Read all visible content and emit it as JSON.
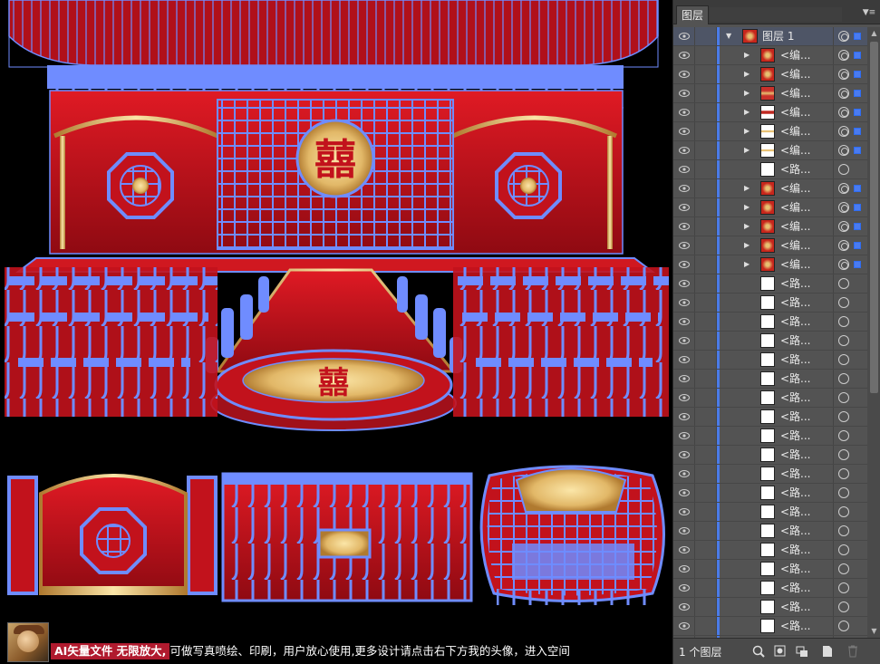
{
  "panel": {
    "tab_label": "图层",
    "menu_icon": "panel-menu-icon",
    "layer_count_text": "1 个图层"
  },
  "layers": {
    "top": {
      "name": "图层 1",
      "expanded": true
    },
    "items": [
      {
        "name": "<编...",
        "thumb": "th-red",
        "expandable": true,
        "target_filled": true
      },
      {
        "name": "<编...",
        "thumb": "th-red",
        "expandable": true,
        "target_filled": true
      },
      {
        "name": "<编...",
        "thumb": "th-gold",
        "expandable": true,
        "target_filled": true
      },
      {
        "name": "<编...",
        "thumb": "th-stripe",
        "expandable": true,
        "target_filled": true
      },
      {
        "name": "<编...",
        "thumb": "th-goldline",
        "expandable": true,
        "target_filled": true
      },
      {
        "name": "<编...",
        "thumb": "th-goldline",
        "expandable": true,
        "target_filled": true
      },
      {
        "name": "<路...",
        "thumb": "th-white",
        "expandable": false,
        "target_filled": false
      },
      {
        "name": "<编...",
        "thumb": "th-red",
        "expandable": true,
        "target_filled": true
      },
      {
        "name": "<编...",
        "thumb": "th-red",
        "expandable": true,
        "target_filled": true
      },
      {
        "name": "<编...",
        "thumb": "th-red",
        "expandable": true,
        "target_filled": true
      },
      {
        "name": "<编...",
        "thumb": "th-red",
        "expandable": true,
        "target_filled": true
      },
      {
        "name": "<编...",
        "thumb": "th-red",
        "expandable": true,
        "target_filled": true
      },
      {
        "name": "<路...",
        "thumb": "th-white",
        "expandable": false,
        "target_filled": false
      },
      {
        "name": "<路...",
        "thumb": "th-white",
        "expandable": false,
        "target_filled": false
      },
      {
        "name": "<路...",
        "thumb": "th-white",
        "expandable": false,
        "target_filled": false
      },
      {
        "name": "<路...",
        "thumb": "th-white",
        "expandable": false,
        "target_filled": false
      },
      {
        "name": "<路...",
        "thumb": "th-white",
        "expandable": false,
        "target_filled": false
      },
      {
        "name": "<路...",
        "thumb": "th-white",
        "expandable": false,
        "target_filled": false
      },
      {
        "name": "<路...",
        "thumb": "th-white",
        "expandable": false,
        "target_filled": false
      },
      {
        "name": "<路...",
        "thumb": "th-white",
        "expandable": false,
        "target_filled": false
      },
      {
        "name": "<路...",
        "thumb": "th-white",
        "expandable": false,
        "target_filled": false
      },
      {
        "name": "<路...",
        "thumb": "th-white",
        "expandable": false,
        "target_filled": false
      },
      {
        "name": "<路...",
        "thumb": "th-white",
        "expandable": false,
        "target_filled": false
      },
      {
        "name": "<路...",
        "thumb": "th-white",
        "expandable": false,
        "target_filled": false
      },
      {
        "name": "<路...",
        "thumb": "th-white",
        "expandable": false,
        "target_filled": false
      },
      {
        "name": "<路...",
        "thumb": "th-white",
        "expandable": false,
        "target_filled": false
      },
      {
        "name": "<路...",
        "thumb": "th-white",
        "expandable": false,
        "target_filled": false
      },
      {
        "name": "<路...",
        "thumb": "th-white",
        "expandable": false,
        "target_filled": false
      },
      {
        "name": "<路...",
        "thumb": "th-white",
        "expandable": false,
        "target_filled": false
      },
      {
        "name": "<路...",
        "thumb": "th-white",
        "expandable": false,
        "target_filled": false
      },
      {
        "name": "<路...",
        "thumb": "th-white",
        "expandable": false,
        "target_filled": false
      },
      {
        "name": "<路...",
        "thumb": "th-white",
        "expandable": false,
        "target_filled": false
      }
    ]
  },
  "footer_buttons": [
    {
      "name": "locate-object-icon"
    },
    {
      "name": "make-clipping-mask-icon"
    },
    {
      "name": "new-sublayer-icon"
    },
    {
      "name": "new-layer-icon"
    },
    {
      "name": "delete-layer-icon"
    }
  ],
  "banner": {
    "highlight": "AI矢量文件 无限放大,",
    "rest": "可做写真喷绘、印刷，用户放心使用,更多设计请点击右下方我的头像，进入空间"
  },
  "colors": {
    "selection_blue": "#4a7bf0",
    "stage_red": "#c2121c",
    "gold": "#e2b868"
  },
  "canvas": {
    "motif": "囍",
    "artwork_name": "wedding-stage-vector-artwork"
  }
}
